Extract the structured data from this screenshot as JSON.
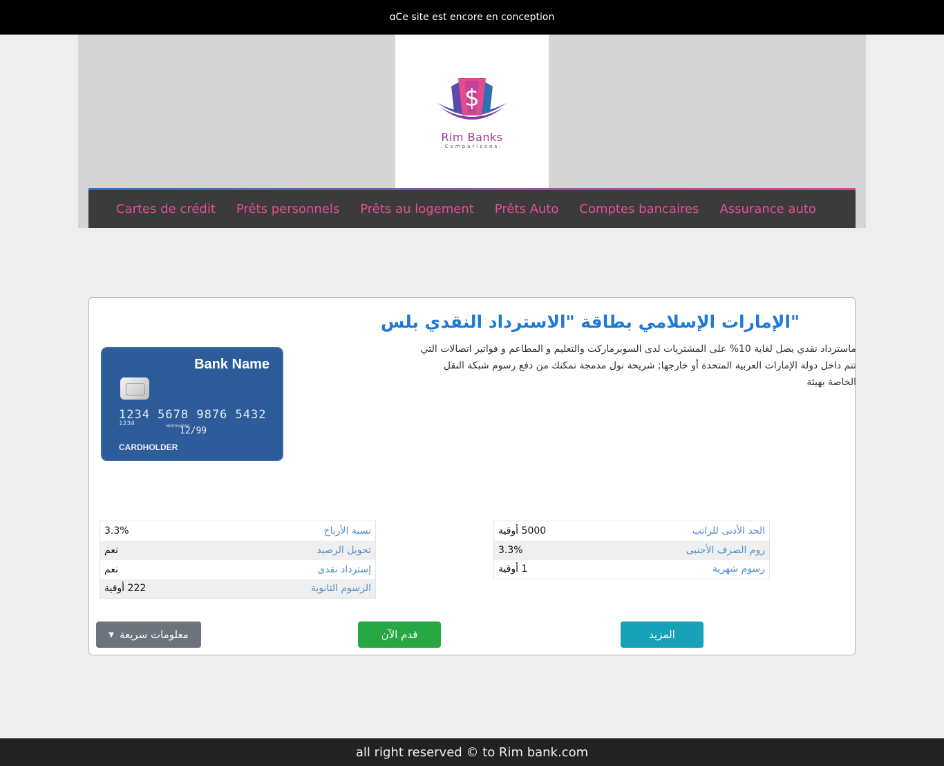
{
  "topbar": {
    "text": "ɑCe site est encore en conception"
  },
  "logo": {
    "title": "Rim Banks",
    "subtitle": ".Comparisons."
  },
  "nav": [
    {
      "label": "Cartes de crédit"
    },
    {
      "label": "Prêts personnels"
    },
    {
      "label": "Prêts au logement"
    },
    {
      "label": "Prêts Auto"
    },
    {
      "label": "Comptes bancaires"
    },
    {
      "label": "Assurance auto"
    }
  ],
  "product": {
    "title": "\"الإمارات الإسلامي بطاقة \"الاسترداد النقدي بلس",
    "description": "ماسترداد نقدي يصل لغاية 10% على المشتريات لدى السوبرماركت والتعليم و المطاعم و فواتير اتصالات التي تتم داخل دولة الإمارات العربية المتحدة أو خارجها; شريحة نول مدمجة تمكنك من دفع رسوم شبكة النقل الخاصة بهيئة"
  },
  "credit_card": {
    "bank_name": "Bank Name",
    "number": "1234 5678 9876 5432",
    "small_number": "1234",
    "valid_label": "MONTH/YEAR",
    "expiry": "12/99",
    "holder": "CARDHOLDER"
  },
  "specs_left": [
    {
      "label": "نسبة الأرباح",
      "value": "3.3%"
    },
    {
      "label": "تحويل الرصيد",
      "value": "نعم"
    },
    {
      "label": "إسترداد نقدى",
      "value": "نعم"
    },
    {
      "label": "الرسوم الثانوية",
      "value": "222 أوقية"
    }
  ],
  "specs_right": [
    {
      "label": "الحد الأدنى للراتب",
      "value": "5000 أوقية"
    },
    {
      "label": "روم الصرف الأجنبى",
      "value": "3.3%"
    },
    {
      "label": "رسوم شهرية",
      "value": "1 أوقية"
    }
  ],
  "buttons": {
    "quick_info": "معلومات سريعة",
    "apply": "قدم الآن",
    "more": "المزيد"
  },
  "footer": {
    "text": "all right reserved © to Rim bank.com"
  },
  "colors": {
    "nav_link": "#ea4c95",
    "title": "#1e7ad6",
    "label": "#4f8fc9",
    "apply": "#28a745",
    "more": "#17a2b8",
    "quick": "#6c757d"
  }
}
